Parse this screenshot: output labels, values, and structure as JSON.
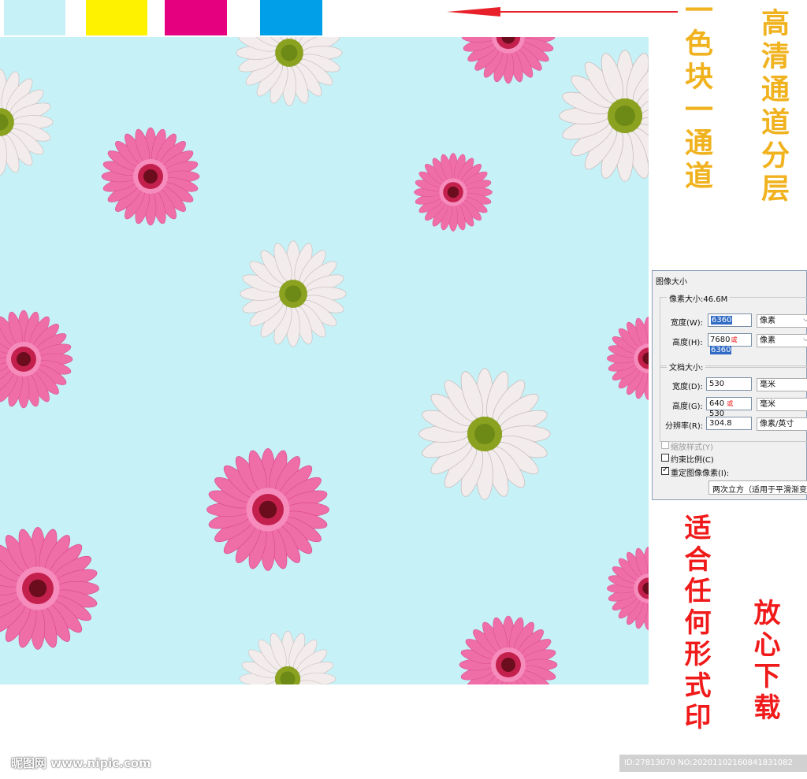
{
  "swatches": [
    {
      "name": "cyan-light",
      "color": "#c6f2f7"
    },
    {
      "name": "yellow",
      "color": "#fff200"
    },
    {
      "name": "magenta",
      "color": "#e4007f"
    },
    {
      "name": "cyan",
      "color": "#009fe8"
    }
  ],
  "colors": {
    "pattern_bg": "#c6f2f7",
    "gold": "#f0b21e",
    "red": "#f01a1a",
    "pink_petal": "#f06ea8",
    "white_petal": "#f3ecec",
    "daisy_center": "#8aa21f"
  },
  "labels": {
    "color_block": "一色块一通道",
    "hd_layers": "高清通道分层",
    "print_any": "适合任何形式印",
    "download": "放心下载"
  },
  "dialog": {
    "title": "图像大小",
    "pixel_group": "像素大小:46.6M",
    "width_label": "宽度(W):",
    "width_value": "6360",
    "width_unit": "像素",
    "height_label": "高度(H):",
    "height_value_old": "7680",
    "height_value": "6360",
    "height_unit": "像素",
    "doc_group": "文档大小:",
    "doc_width_label": "宽度(D):",
    "doc_width_value": "530",
    "doc_width_unit": "毫米",
    "doc_height_label": "高度(G):",
    "doc_height_value_old": "640",
    "doc_height_value": "530",
    "doc_height_unit": "毫米",
    "resolution_label": "分辨率(R):",
    "resolution_value": "304.8",
    "resolution_unit": "像素/英寸",
    "scale_styles": "缩放样式(Y)",
    "constrain": "约束比例(C)",
    "resample": "重定图像像素(I):",
    "resample_method": "两次立方（适用于平滑渐变",
    "handwritten_mark": "或"
  },
  "watermark": "昵图网 www.nipic.com",
  "id_text": "ID:27813070 NO:20201102160841831082"
}
